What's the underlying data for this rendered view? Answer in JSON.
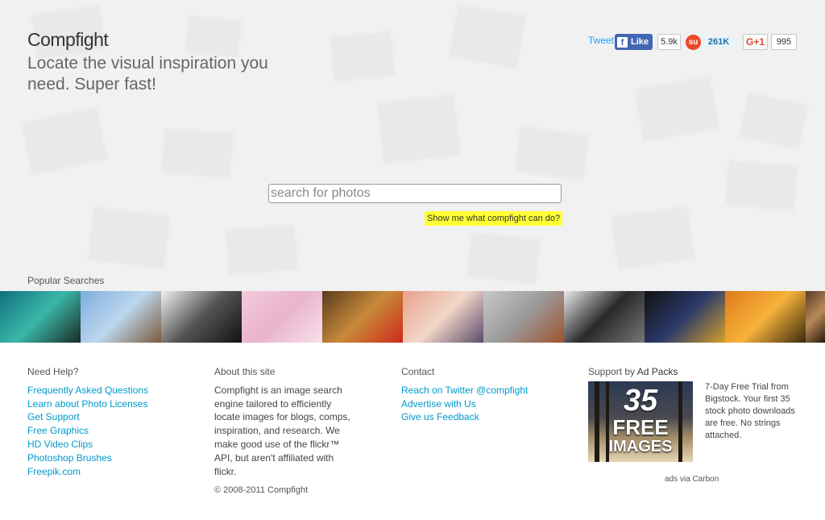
{
  "header": {
    "brand": "Compfight",
    "tagline": "Locate the visual inspiration you need. Super fast!"
  },
  "social": {
    "tweet_label": "Tweet",
    "fb_like_label": "Like",
    "fb_count": "5.9k",
    "stumble_count": "261K",
    "gplus_label": "G+1",
    "gplus_count": "995"
  },
  "search": {
    "placeholder": "search for photos",
    "demo_link": "Show me what compfight can do?"
  },
  "popular": {
    "label": "Popular Searches",
    "thumbs": [
      {
        "name": "popular-thumb-face-paint",
        "colors": [
          "#0f6f7f",
          "#3ab7a8",
          "#1a2a22"
        ]
      },
      {
        "name": "popular-thumb-pier",
        "colors": [
          "#7eaee0",
          "#bcd6ee",
          "#7a5a3a"
        ]
      },
      {
        "name": "popular-thumb-spiral",
        "colors": [
          "#f0f0f0",
          "#555555",
          "#111111"
        ]
      },
      {
        "name": "popular-thumb-girl-pink-wall",
        "colors": [
          "#f4c9dc",
          "#e9b4cc",
          "#f8e0ea"
        ]
      },
      {
        "name": "popular-thumb-dog",
        "colors": [
          "#5a3a1e",
          "#c88a3a",
          "#cc2a1a"
        ]
      },
      {
        "name": "popular-thumb-geisha",
        "colors": [
          "#e8a08a",
          "#f3d7c9",
          "#5a4a6a"
        ]
      },
      {
        "name": "popular-thumb-ducks",
        "colors": [
          "#c8c8c8",
          "#9a9a9a",
          "#a0522d"
        ]
      },
      {
        "name": "popular-thumb-gadgets",
        "colors": [
          "#eaeaea",
          "#2a2a2a",
          "#777777"
        ]
      },
      {
        "name": "popular-thumb-suit",
        "colors": [
          "#111111",
          "#2b3a6a",
          "#d4a02a"
        ]
      },
      {
        "name": "popular-thumb-flower",
        "colors": [
          "#e07a1a",
          "#f6b23a",
          "#3a2a10"
        ]
      },
      {
        "name": "popular-thumb-extra",
        "colors": [
          "#5a3a2a",
          "#b88a5a",
          "#2a1a0a"
        ]
      }
    ]
  },
  "footer": {
    "help": {
      "title": "Need Help?",
      "links": [
        "Frequently Asked Questions",
        "Learn about Photo Licenses",
        "Get Support",
        "Free Graphics",
        "HD Video Clips",
        "Photoshop Brushes",
        "Freepik.com"
      ]
    },
    "about": {
      "title": "About this site",
      "text": "Compfight is an image search engine tailored to efficiently locate images for blogs, comps, inspiration, and research. We make good use of the flickr™ API, but aren't affiliated with flickr.",
      "copyright": "© 2008-2011 Compfight"
    },
    "contact": {
      "title": "Contact",
      "links": [
        "Reach on Twitter @compfight",
        "Advertise with Us",
        "Give us Feedback"
      ]
    },
    "ad": {
      "title_prefix": "Support by ",
      "title_brand": "Ad Packs",
      "image_number": "35",
      "image_line1": "FREE",
      "image_line2": "IMAGES",
      "text": "7-Day Free Trial from Bigstock. Your first 35 stock photo downloads are free. No strings attached.",
      "via": "ads via Carbon"
    }
  }
}
